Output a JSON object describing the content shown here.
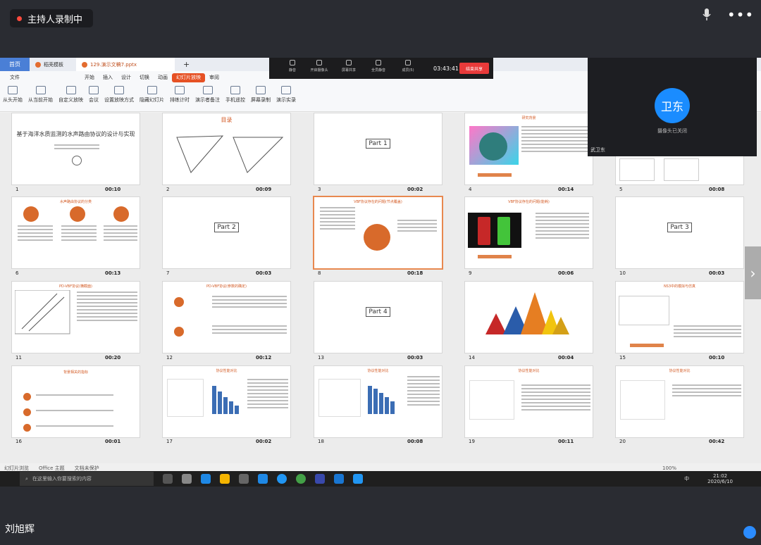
{
  "meeting": {
    "recording_label": "主持人录制中",
    "mic_icon": "microphone-icon",
    "more_icon": "more-icon",
    "more_glyph": "•••",
    "presenter_name": "刘旭辉",
    "next_glyph": "›"
  },
  "float_toolbar": {
    "items": [
      "静音",
      "开启摄像头",
      "屏幕共享",
      "全员静音",
      "成员(5)"
    ],
    "time": "03:43:41",
    "end_label": "结束共享"
  },
  "video_tile": {
    "avatar_text": "卫东",
    "camera_status": "摄像头已关闭",
    "name": "武卫东"
  },
  "wps": {
    "tabs": {
      "home": "首页",
      "template": "稻壳模板",
      "file": "129.演示文稿7.pptx",
      "add": "+"
    },
    "menus": [
      "文件",
      "开始",
      "插入",
      "设计",
      "切换",
      "动画",
      "幻灯片放映",
      "审阅"
    ],
    "active_menu": "幻灯片放映",
    "ribbon": [
      "从头开始",
      "从当前开始",
      "自定义放映",
      "会议",
      "设置放映方式",
      "隐藏幻灯片",
      "排练计时",
      "演示者备注",
      "手机遥控",
      "屏幕录制",
      "演示实录"
    ],
    "status": {
      "view": "幻灯片浏览",
      "theme": "Office 主题",
      "protect": "文档未保护",
      "zoom": "100%"
    }
  },
  "slides": [
    {
      "num": "1",
      "time": "00:10",
      "title": "基于海洋水质监测的水声路由协议的设计与实现"
    },
    {
      "num": "2",
      "time": "00:09",
      "title": "目录"
    },
    {
      "num": "3",
      "time": "00:02",
      "title": "Part 1"
    },
    {
      "num": "4",
      "time": "00:14",
      "title": "研究背景"
    },
    {
      "num": "5",
      "time": "00:08",
      "title": ""
    },
    {
      "num": "6",
      "time": "00:13",
      "title": "水声路由协议的分类"
    },
    {
      "num": "7",
      "time": "00:03",
      "title": "Part 2"
    },
    {
      "num": "8",
      "time": "00:18",
      "title": "VBF协议存在的问题(节点覆盖)"
    },
    {
      "num": "9",
      "time": "00:06",
      "title": "VBF协议存在的问题(能耗)"
    },
    {
      "num": "10",
      "time": "00:03",
      "title": "Part 3"
    },
    {
      "num": "11",
      "time": "00:20",
      "title": "PD-VBF协议(横截面)"
    },
    {
      "num": "12",
      "time": "00:12",
      "title": "PD-VBF协议(参数的确定)"
    },
    {
      "num": "13",
      "time": "00:03",
      "title": "Part 4"
    },
    {
      "num": "14",
      "time": "00:04",
      "title": ""
    },
    {
      "num": "15",
      "time": "00:10",
      "title": "NS3中的模拟与仿真"
    },
    {
      "num": "16",
      "time": "00:01",
      "title": "背景相关的指标"
    },
    {
      "num": "17",
      "time": "00:02",
      "title": "协议性能对比"
    },
    {
      "num": "18",
      "time": "00:08",
      "title": "协议性能对比"
    },
    {
      "num": "19",
      "time": "00:11",
      "title": "协议性能对比"
    },
    {
      "num": "20",
      "time": "00:42",
      "title": "协议性能对比"
    }
  ],
  "taskbar": {
    "search_placeholder": "在这里输入你要搜索的内容",
    "time": "21:02",
    "date": "2020/6/10",
    "ime": "中"
  }
}
